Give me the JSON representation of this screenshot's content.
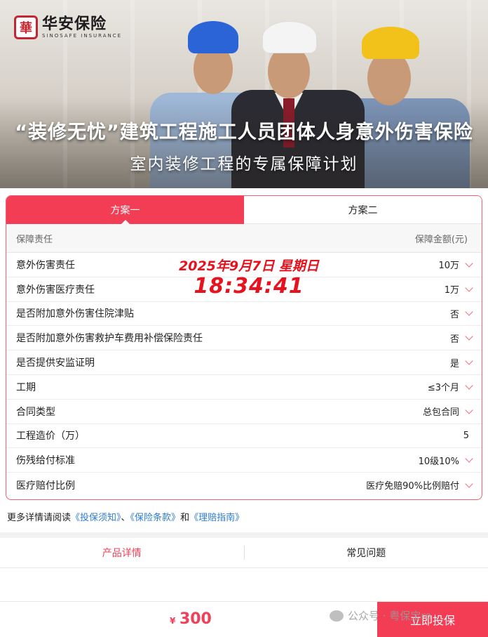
{
  "banner": {
    "logo_mark": "華",
    "logo_cn": "华安保险",
    "logo_en": "SINOSAFE INSURANCE",
    "title": "“装修无忧”建筑工程施工人员团体人身意外伤害保险",
    "subtitle": "室内装修工程的专属保障计划"
  },
  "plan_tabs": [
    {
      "label": "方案一",
      "active": true
    },
    {
      "label": "方案二",
      "active": false
    }
  ],
  "table_header": {
    "left": "保障责任",
    "right": "保障金额(元)"
  },
  "rows": [
    {
      "label": "意外伤害责任",
      "value": "10万",
      "chevron": true
    },
    {
      "label": "意外伤害医疗责任",
      "value": "1万",
      "chevron": true
    },
    {
      "label": "是否附加意外伤害住院津贴",
      "value": "否",
      "chevron": true
    },
    {
      "label": "是否附加意外伤害救护车费用补偿保险责任",
      "value": "否",
      "chevron": true
    },
    {
      "label": "是否提供安监证明",
      "value": "是",
      "chevron": true
    },
    {
      "label": "工期",
      "value": "≤3个月",
      "chevron": true
    },
    {
      "label": "合同类型",
      "value": "总包合同",
      "chevron": true
    },
    {
      "label": "工程造价（万）",
      "value": "5",
      "chevron": false
    },
    {
      "label": "伤残给付标准",
      "value": "10级10%",
      "chevron": true
    },
    {
      "label": "医疗赔付比例",
      "value": "医疗免赔90%比例赔付",
      "chevron": true
    }
  ],
  "stamp": {
    "date": "2025年9月7日 星期日",
    "time": "18:34:41"
  },
  "more": {
    "prefix": "更多详情请阅读",
    "link1": "《投保须知》",
    "sep1": "、",
    "link2": "《保险条款》",
    "sep2": "和",
    "link3": "《理赔指南》"
  },
  "detail_tabs": [
    {
      "label": "产品详情",
      "active": true
    },
    {
      "label": "常见问题",
      "active": false
    }
  ],
  "bottom": {
    "currency": "¥",
    "price": "300",
    "buy_label": "立即投保"
  },
  "watermark": "公众号 · 粤保宝ro",
  "colors": {
    "accent": "#f23d55",
    "link": "#2f7cd3",
    "stamp": "#e6121e"
  }
}
